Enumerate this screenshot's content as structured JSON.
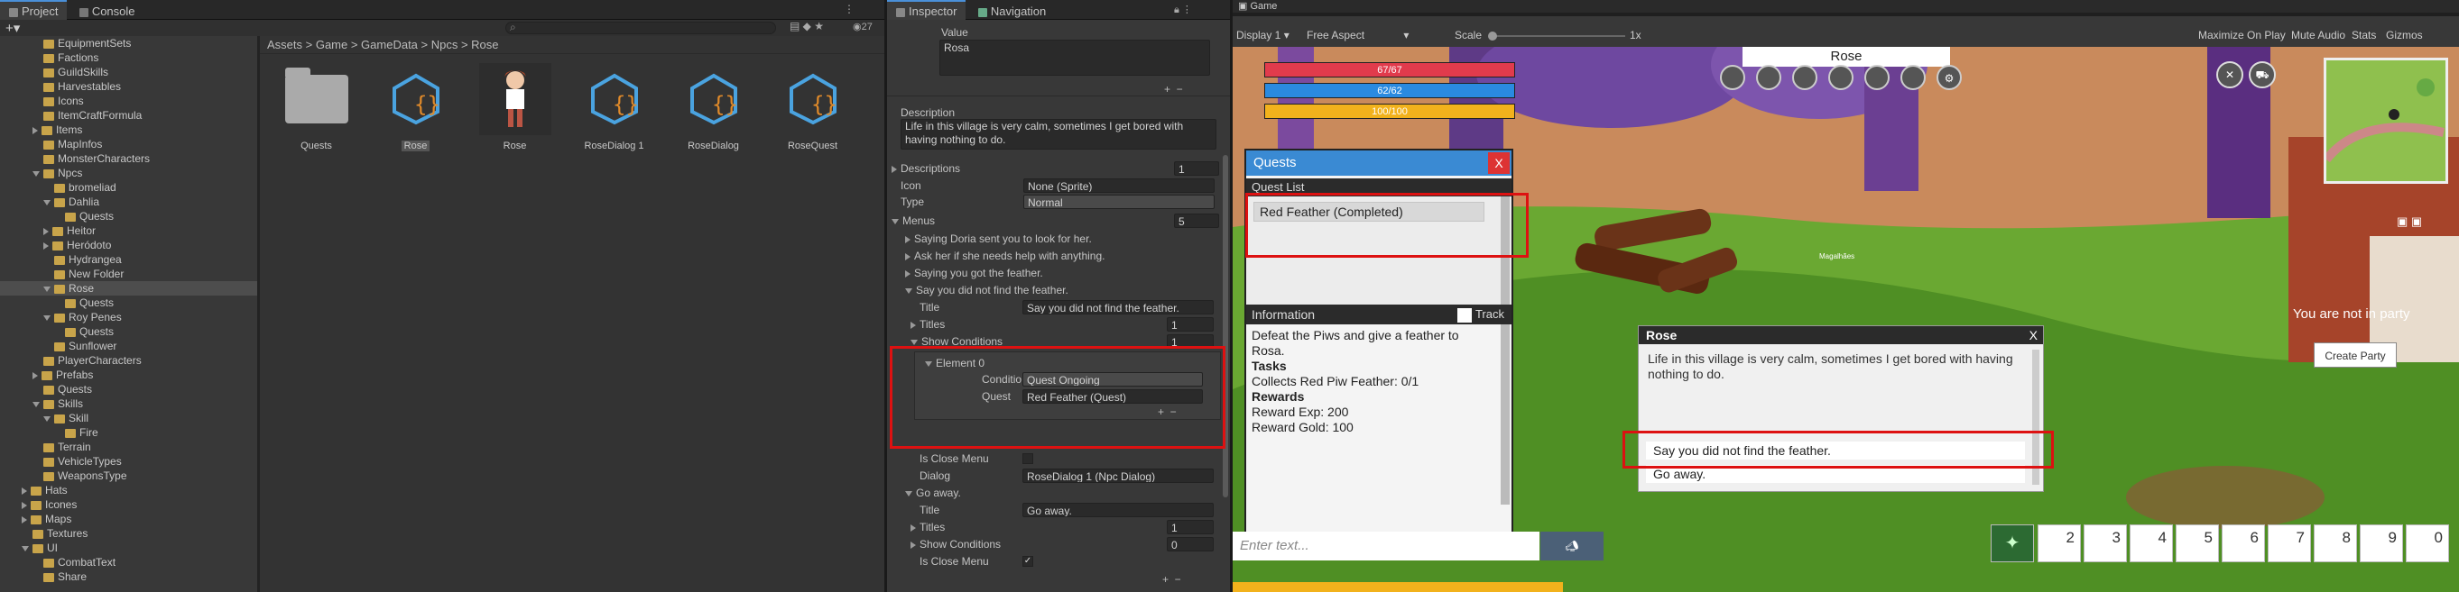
{
  "project": {
    "tabs": [
      "Project",
      "Console"
    ],
    "hidden_count": "27",
    "tree": [
      {
        "label": "EquipmentSets",
        "d": 3,
        "x": false
      },
      {
        "label": "Factions",
        "d": 3,
        "x": false
      },
      {
        "label": "GuildSkills",
        "d": 3,
        "x": false
      },
      {
        "label": "Harvestables",
        "d": 3,
        "x": false
      },
      {
        "label": "Icons",
        "d": 3,
        "x": false
      },
      {
        "label": "ItemCraftFormula",
        "d": 3,
        "x": false
      },
      {
        "label": "Items",
        "d": 3,
        "x": "c"
      },
      {
        "label": "MapInfos",
        "d": 3,
        "x": false
      },
      {
        "label": "MonsterCharacters",
        "d": 3,
        "x": false
      },
      {
        "label": "Npcs",
        "d": 3,
        "x": "o"
      },
      {
        "label": "bromeliad",
        "d": 4,
        "x": false
      },
      {
        "label": "Dahlia",
        "d": 4,
        "x": "o"
      },
      {
        "label": "Quests",
        "d": 5,
        "x": false
      },
      {
        "label": "Heitor",
        "d": 4,
        "x": "c"
      },
      {
        "label": "Heródoto",
        "d": 4,
        "x": "c"
      },
      {
        "label": "Hydrangea",
        "d": 4,
        "x": false
      },
      {
        "label": "New Folder",
        "d": 4,
        "x": false
      },
      {
        "label": "Rose",
        "d": 4,
        "x": "o",
        "sel": true
      },
      {
        "label": "Quests",
        "d": 5,
        "x": false
      },
      {
        "label": "Roy Penes",
        "d": 4,
        "x": "o"
      },
      {
        "label": "Quests",
        "d": 5,
        "x": false
      },
      {
        "label": "Sunflower",
        "d": 4,
        "x": false
      },
      {
        "label": "PlayerCharacters",
        "d": 3,
        "x": false
      },
      {
        "label": "Prefabs",
        "d": 3,
        "x": "c"
      },
      {
        "label": "Quests",
        "d": 3,
        "x": false
      },
      {
        "label": "Skills",
        "d": 3,
        "x": "o"
      },
      {
        "label": "Skill",
        "d": 4,
        "x": "o"
      },
      {
        "label": "Fire",
        "d": 5,
        "x": false
      },
      {
        "label": "Terrain",
        "d": 3,
        "x": false
      },
      {
        "label": "VehicleTypes",
        "d": 3,
        "x": false
      },
      {
        "label": "WeaponsType",
        "d": 3,
        "x": false
      },
      {
        "label": "Hats",
        "d": 2,
        "x": "c"
      },
      {
        "label": "Icones",
        "d": 2,
        "x": "c"
      },
      {
        "label": "Maps",
        "d": 2,
        "x": "c"
      },
      {
        "label": "Textures",
        "d": 2,
        "x": false
      },
      {
        "label": "UI",
        "d": 2,
        "x": "o"
      },
      {
        "label": "CombatText",
        "d": 3,
        "x": false
      },
      {
        "label": "Share",
        "d": 3,
        "x": false
      }
    ],
    "breadcrumb": "Assets > Game > GameData > Npcs > Rose",
    "assets": [
      "Quests",
      "Rose",
      "Rose",
      "RoseDialog 1",
      "RoseDialog",
      "RoseQuest"
    ]
  },
  "inspector": {
    "tabs": [
      "Inspector",
      "Navigation"
    ],
    "value_label": "Value",
    "value_text": "Rosa",
    "description_label": "Description",
    "description_text": "Life in this village is very calm, sometimes I get bored with having nothing to do.",
    "descriptions_label": "Descriptions",
    "descriptions_count": "1",
    "icon_label": "Icon",
    "icon_value": "None (Sprite)",
    "type_label": "Type",
    "type_value": "Normal",
    "menus_label": "Menus",
    "menus_count": "5",
    "menu_items": [
      "Saying Doria sent you to look for her.",
      "Ask her if she needs help with anything.",
      "Saying you got the feather.",
      "Say you did not find the feather."
    ],
    "title_label": "Title",
    "title_value": "Say you did not find the feather.",
    "titles_label": "Titles",
    "titles_count": "1",
    "show_cond_label": "Show Conditions",
    "show_cond_count": "1",
    "element_label": "Element 0",
    "condition_label": "Conditio",
    "condition_value": "Quest Ongoing",
    "quest_label": "Quest",
    "quest_value": "Red Feather (Quest)",
    "is_close_label": "Is Close Menu",
    "dialog_label": "Dialog",
    "dialog_value": "RoseDialog 1 (Npc Dialog)",
    "go_away_label": "Go away.",
    "title2_value": "Go away.",
    "titles2_count": "1",
    "show_cond2_count": "0"
  },
  "game": {
    "tab": "Game",
    "display": "Display 1",
    "aspect": "Free Aspect",
    "scale_label": "Scale",
    "scale_value": "1x",
    "toolbar_right": [
      "Maximize On Play",
      "Mute Audio",
      "Stats",
      "Gizmos"
    ],
    "hp": "67/67",
    "mp": "62/62",
    "stamina": "100/100",
    "target_name": "Rose",
    "quests_title": "Quests",
    "close": "X",
    "quest_list_label": "Quest List",
    "quest_entry": "Red Feather (Completed)",
    "info_label": "Information",
    "track_label": "Track",
    "info_text": "Defeat the Piws and give a feather to Rosa.",
    "tasks_label": "Tasks",
    "task_line": "Collects Red Piw Feather: 0/1",
    "rewards_label": "Rewards",
    "reward_exp": "Reward Exp: 200",
    "reward_gold": "Reward Gold: 100",
    "dialog_name": "Rose",
    "dialog_text": "Life in this village is very calm, sometimes I get bored with having nothing to do.",
    "option1": "Say you did not find the feather.",
    "option2": "Go away.",
    "party_text": "You are not in party",
    "create_party": "Create Party",
    "chat_placeholder": "Enter text...",
    "hotkeys": [
      "2",
      "3",
      "4",
      "5",
      "6",
      "7",
      "8",
      "9",
      "0"
    ],
    "npc_label": "Magalhães"
  }
}
